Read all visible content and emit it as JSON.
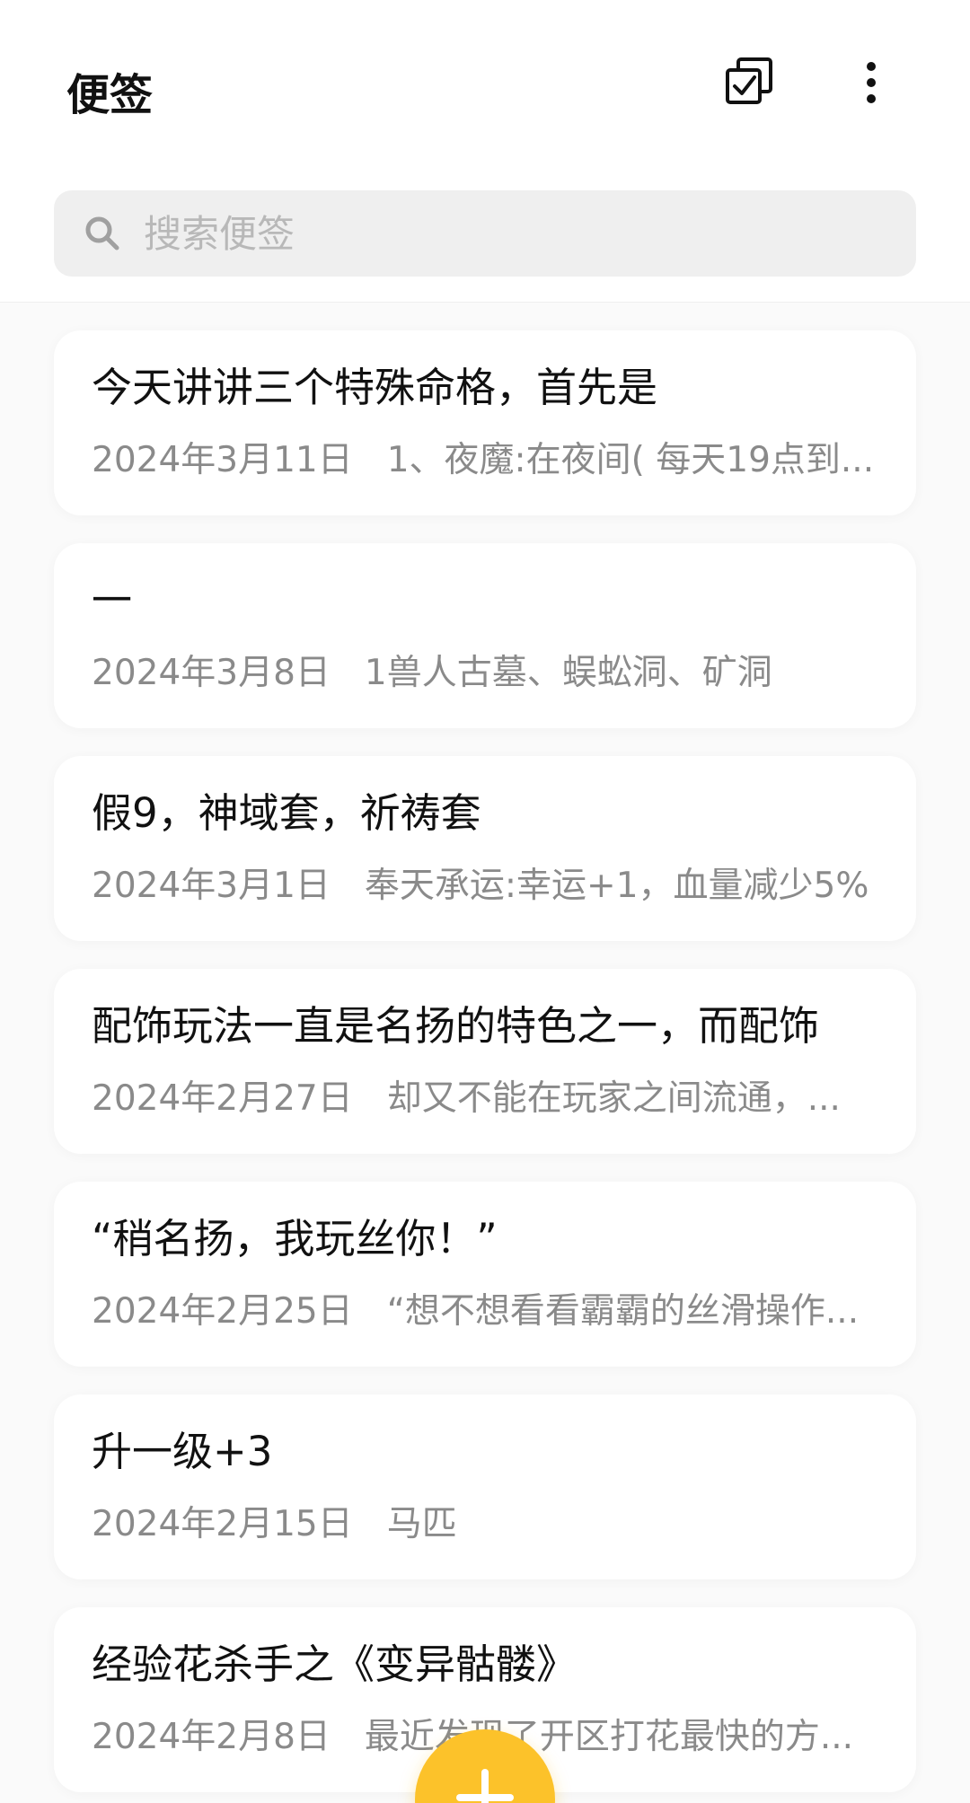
{
  "header": {
    "title": "便签",
    "select_icon": "multi-select-icon",
    "more_icon": "more-vertical-icon"
  },
  "search": {
    "placeholder": "搜索便签",
    "icon": "search-icon"
  },
  "notes": [
    {
      "title": "今天讲讲三个特殊命格，首先是",
      "date": "2024年3月11日",
      "preview": "1、夜魔:在夜间( 每天19点到..."
    },
    {
      "title": "一",
      "date": "2024年3月8日",
      "preview": "1兽人古墓、蜈蚣洞、矿洞"
    },
    {
      "title": "假9，神域套，祈祷套",
      "date": "2024年3月1日",
      "preview": "奉天承运:幸运+1，血量减少5%"
    },
    {
      "title": "配饰玩法一直是名扬的特色之一，而配饰",
      "date": "2024年2月27日",
      "preview": "却又不能在玩家之间流通，..."
    },
    {
      "title": "“稍名扬，我玩丝你！”",
      "date": "2024年2月25日",
      "preview": "“想不想看看霸霸的丝滑操作..."
    },
    {
      "title": "升一级+3",
      "date": "2024年2月15日",
      "preview": "马匹"
    },
    {
      "title": "经验花杀手之《变异骷髅》",
      "date": "2024年2月8日",
      "preview": "最近发现了开区打花最快的方..."
    }
  ],
  "fab": {
    "icon": "plus-icon"
  },
  "colors": {
    "accent": "#fcc22a",
    "background": "#fafafa",
    "card": "#ffffff",
    "title_text": "#111111",
    "meta_text": "#8a8a8a"
  }
}
